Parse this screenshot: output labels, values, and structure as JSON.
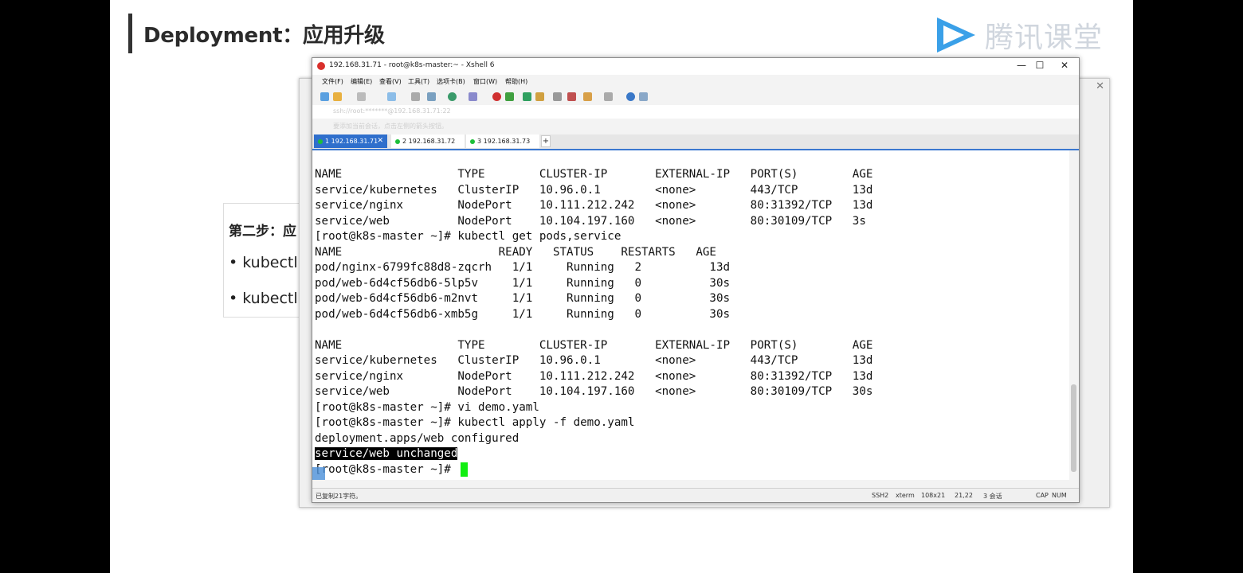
{
  "slide": {
    "title": "Deployment：应用升级",
    "logo_text": "腾讯课堂",
    "step_title": "第二步：应",
    "bullets": [
      "kubectl",
      "kubectl"
    ]
  },
  "window": {
    "title": "192.168.31.71 - root@k8s-master:~ - Xshell 6",
    "minimize": "—",
    "maximize": "☐",
    "close": "✕"
  },
  "menu": [
    "文件(F)",
    "编辑(E)",
    "查看(V)",
    "工具(T)",
    "选项卡(B)",
    "窗口(W)",
    "帮助(H)"
  ],
  "address": "ssh://root:*******@192.168.31.71:22",
  "hint": "要添加当前会话，点击左侧的箭头按钮。",
  "tabs": [
    {
      "label": "1 192.168.31.71",
      "active": true
    },
    {
      "label": "2 192.168.31.72",
      "active": false
    },
    {
      "label": "3 192.168.31.73",
      "active": false
    }
  ],
  "tab_add": "+",
  "terminal_lines": [
    "NAME                 TYPE        CLUSTER-IP       EXTERNAL-IP   PORT(S)        AGE",
    "service/kubernetes   ClusterIP   10.96.0.1        <none>        443/TCP        13d",
    "service/nginx        NodePort    10.111.212.242   <none>        80:31392/TCP   13d",
    "service/web          NodePort    10.104.197.160   <none>        80:30109/TCP   3s",
    "[root@k8s-master ~]# kubectl get pods,service",
    "NAME                       READY   STATUS    RESTARTS   AGE",
    "pod/nginx-6799fc88d8-zqcrh   1/1     Running   2          13d",
    "pod/web-6d4cf56db6-5lp5v     1/1     Running   0          30s",
    "pod/web-6d4cf56db6-m2nvt     1/1     Running   0          30s",
    "pod/web-6d4cf56db6-xmb5g     1/1     Running   0          30s",
    "",
    "NAME                 TYPE        CLUSTER-IP       EXTERNAL-IP   PORT(S)        AGE",
    "service/kubernetes   ClusterIP   10.96.0.1        <none>        443/TCP        13d",
    "service/nginx        NodePort    10.111.212.242   <none>        80:31392/TCP   13d",
    "service/web          NodePort    10.104.197.160   <none>        80:30109/TCP   30s",
    "[root@k8s-master ~]# vi demo.yaml",
    "[root@k8s-master ~]# kubectl apply -f demo.yaml",
    "deployment.apps/web configured",
    "service/web unchanged",
    "[root@k8s-master ~]# "
  ],
  "status": {
    "left": "已复制21字符。",
    "protocol": "SSH2",
    "term": "xterm",
    "size": "108x21",
    "pos": "21,22",
    "sessions": "3 会话",
    "caps": "CAP",
    "num": "NUM"
  }
}
